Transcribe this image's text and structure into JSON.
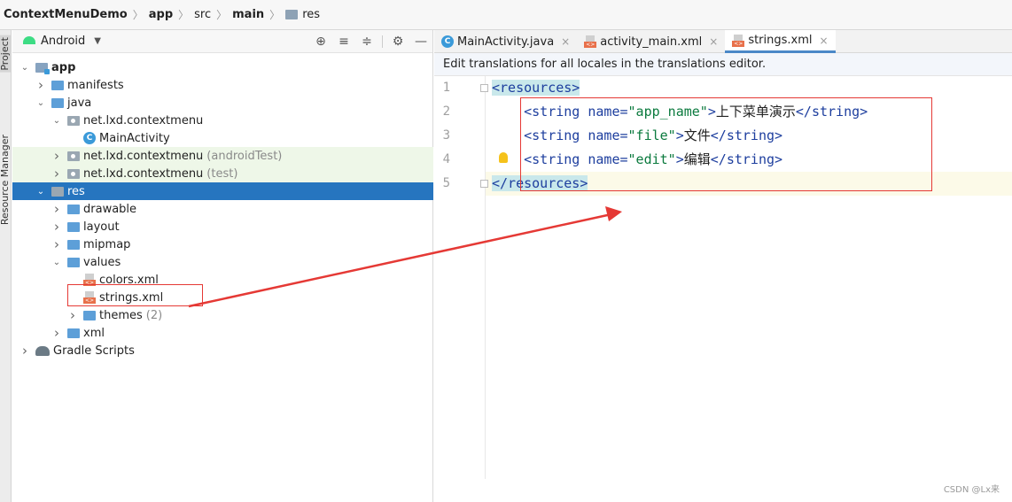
{
  "breadcrumb": [
    {
      "label": "ContextMenuDemo",
      "bold": true
    },
    {
      "label": "app",
      "bold": true
    },
    {
      "label": "src",
      "bold": false
    },
    {
      "label": "main",
      "bold": true
    },
    {
      "label": "res",
      "bold": false
    }
  ],
  "tool_strip": {
    "project_tab": "Project",
    "resource_tab": "Resource Manager"
  },
  "project_panel": {
    "view_selector": "Android",
    "tree": [
      {
        "label": "app",
        "suffix": "",
        "icon": "app-folder-icon",
        "arrow": "down",
        "bold": true,
        "indent": 0,
        "state": ""
      },
      {
        "label": "manifests",
        "suffix": "",
        "icon": "folder-icon",
        "arrow": "right",
        "bold": false,
        "indent": 1,
        "state": ""
      },
      {
        "label": "java",
        "suffix": "",
        "icon": "folder-icon",
        "arrow": "down",
        "bold": false,
        "indent": 1,
        "state": ""
      },
      {
        "label": "net.lxd.contextmenu",
        "suffix": "",
        "icon": "package-icon",
        "arrow": "down",
        "bold": false,
        "indent": 2,
        "state": ""
      },
      {
        "label": "MainActivity",
        "suffix": "",
        "icon": "class-icon",
        "arrow": "",
        "bold": false,
        "indent": 3,
        "state": ""
      },
      {
        "label": "net.lxd.contextmenu",
        "suffix": "(androidTest)",
        "icon": "package-icon",
        "arrow": "right",
        "bold": false,
        "indent": 2,
        "state": "green"
      },
      {
        "label": "net.lxd.contextmenu",
        "suffix": "(test)",
        "icon": "package-icon",
        "arrow": "right",
        "bold": false,
        "indent": 2,
        "state": "green"
      },
      {
        "label": "res",
        "suffix": "",
        "icon": "res-folder-icon",
        "arrow": "down",
        "bold": false,
        "indent": 1,
        "state": "selected"
      },
      {
        "label": "drawable",
        "suffix": "",
        "icon": "folder-icon",
        "arrow": "right",
        "bold": false,
        "indent": 2,
        "state": ""
      },
      {
        "label": "layout",
        "suffix": "",
        "icon": "folder-icon",
        "arrow": "right",
        "bold": false,
        "indent": 2,
        "state": ""
      },
      {
        "label": "mipmap",
        "suffix": "",
        "icon": "folder-icon",
        "arrow": "right",
        "bold": false,
        "indent": 2,
        "state": ""
      },
      {
        "label": "values",
        "suffix": "",
        "icon": "folder-icon",
        "arrow": "down",
        "bold": false,
        "indent": 2,
        "state": ""
      },
      {
        "label": "colors.xml",
        "suffix": "",
        "icon": "xml-file-icon",
        "arrow": "",
        "bold": false,
        "indent": 3,
        "state": ""
      },
      {
        "label": "strings.xml",
        "suffix": "",
        "icon": "xml-file-icon",
        "arrow": "",
        "bold": false,
        "indent": 3,
        "state": ""
      },
      {
        "label": "themes",
        "suffix": "(2)",
        "icon": "folder-icon",
        "arrow": "right",
        "bold": false,
        "indent": 3,
        "state": ""
      },
      {
        "label": "xml",
        "suffix": "",
        "icon": "folder-icon",
        "arrow": "right",
        "bold": false,
        "indent": 2,
        "state": ""
      },
      {
        "label": "Gradle Scripts",
        "suffix": "",
        "icon": "gradle-icon",
        "arrow": "right",
        "bold": false,
        "indent": 0,
        "state": ""
      }
    ]
  },
  "editor": {
    "tabs": [
      {
        "label": "MainActivity.java",
        "icon": "class-icon",
        "active": false
      },
      {
        "label": "activity_main.xml",
        "icon": "xml-file-icon",
        "active": false
      },
      {
        "label": "strings.xml",
        "icon": "xml-file-icon",
        "active": true
      }
    ],
    "banner": "Edit translations for all locales in the translations editor.",
    "lines": [
      {
        "n": "1",
        "parts": [
          [
            "tag-hl",
            "<resources>"
          ]
        ]
      },
      {
        "n": "2",
        "parts": [
          [
            "plain",
            "    "
          ],
          [
            "tag",
            "<string "
          ],
          [
            "attr",
            "name="
          ],
          [
            "val",
            "\"app_name\""
          ],
          [
            "tag",
            ">"
          ],
          [
            "plain",
            "上下菜单演示"
          ],
          [
            "tag",
            "</string>"
          ]
        ]
      },
      {
        "n": "3",
        "parts": [
          [
            "plain",
            "    "
          ],
          [
            "tag",
            "<string "
          ],
          [
            "attr",
            "name="
          ],
          [
            "val",
            "\"file\""
          ],
          [
            "tag",
            ">"
          ],
          [
            "plain",
            "文件"
          ],
          [
            "tag",
            "</string>"
          ]
        ]
      },
      {
        "n": "4",
        "parts": [
          [
            "plain",
            "    "
          ],
          [
            "tag",
            "<string "
          ],
          [
            "attr",
            "name="
          ],
          [
            "val",
            "\"edit\""
          ],
          [
            "tag",
            ">"
          ],
          [
            "plain",
            "编辑"
          ],
          [
            "tag",
            "</string>"
          ]
        ]
      },
      {
        "n": "5",
        "parts": [
          [
            "tag-hl",
            "</resources>"
          ]
        ]
      }
    ]
  },
  "watermark": "CSDN @Lx来",
  "colors": {
    "selection": "#2675bf",
    "annotation_red": "#e53935",
    "test_row_green": "#eef7e8"
  }
}
